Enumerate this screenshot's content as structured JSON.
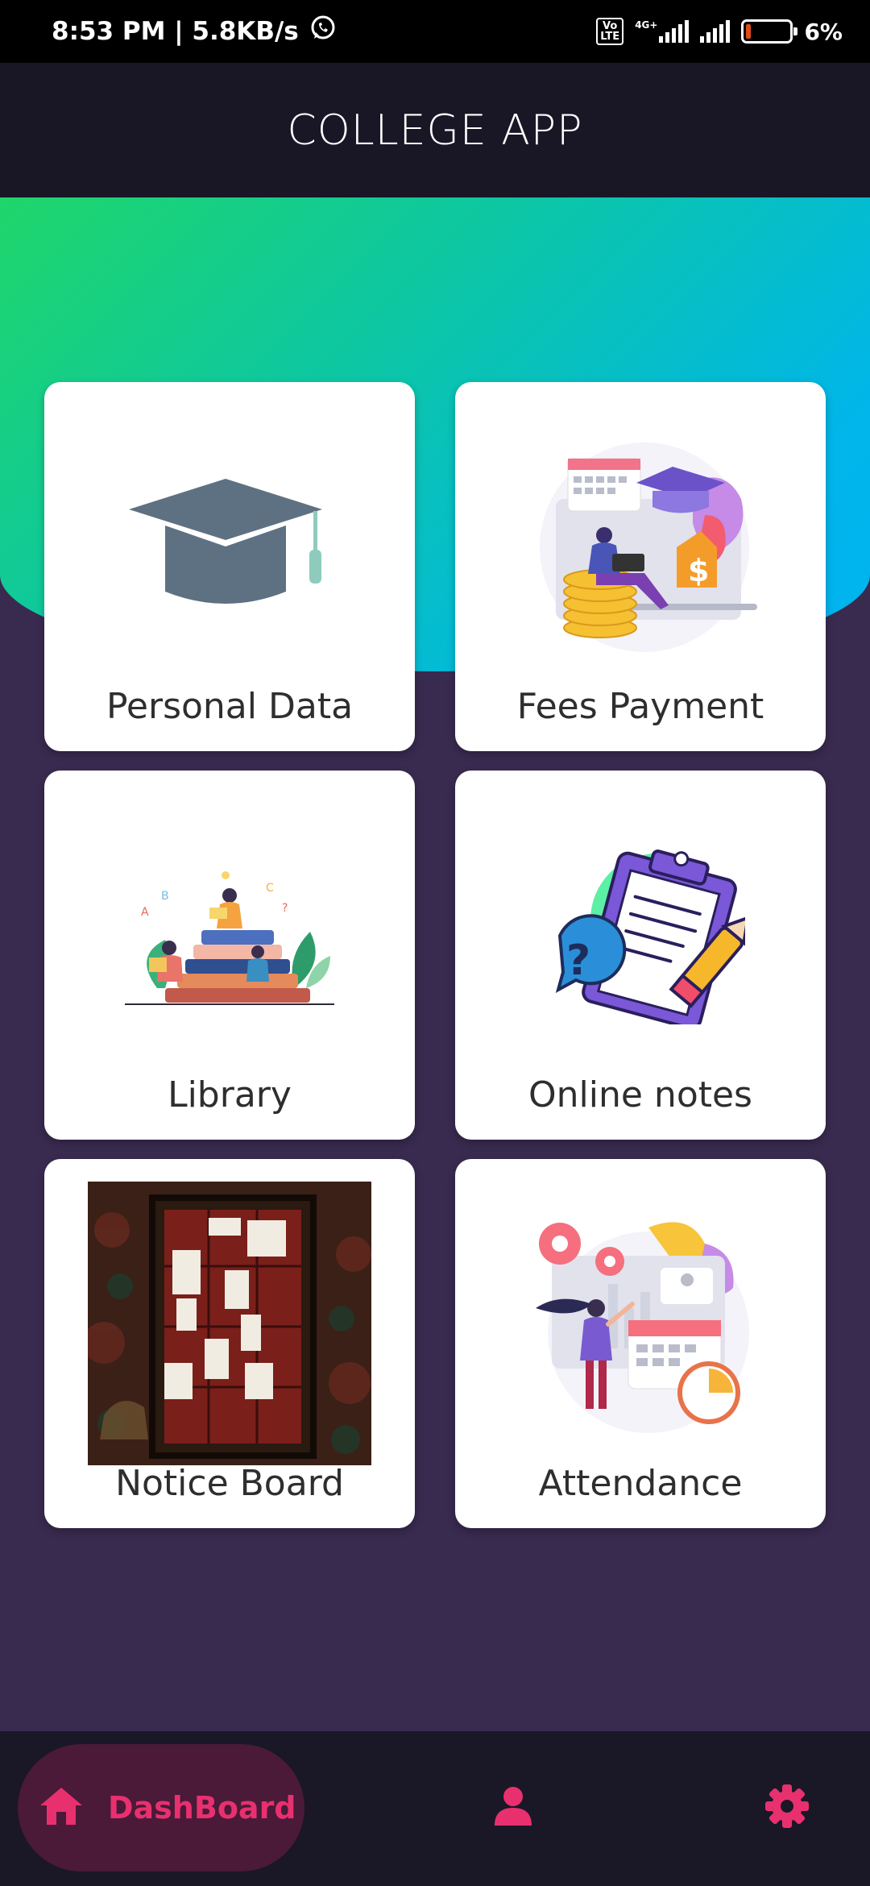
{
  "status_bar": {
    "time_speed": "8:53 PM | 5.8KB/s",
    "volte": "Vo LTE",
    "network": "4G+",
    "battery": "6%"
  },
  "app_bar": {
    "title": "COLLEGE APP"
  },
  "cards": [
    {
      "label": "Personal Data",
      "icon": "graduation-cap-icon"
    },
    {
      "label": "Fees Payment",
      "icon": "fees-payment-illustration"
    },
    {
      "label": "Library",
      "icon": "library-illustration"
    },
    {
      "label": "Online notes",
      "icon": "clipboard-notes-illustration"
    },
    {
      "label": "Notice Board",
      "icon": "notice-board-photo"
    },
    {
      "label": "Attendance",
      "icon": "attendance-illustration"
    }
  ],
  "bottom_nav": {
    "home_label": "DashBoard",
    "items": [
      "home-icon",
      "profile-icon",
      "settings-icon"
    ],
    "accent_color": "#e8306f"
  },
  "colors": {
    "background": "#392a4f",
    "app_bar": "#191625",
    "gradient_start": "#1fd66a",
    "gradient_end": "#00b3f0"
  }
}
